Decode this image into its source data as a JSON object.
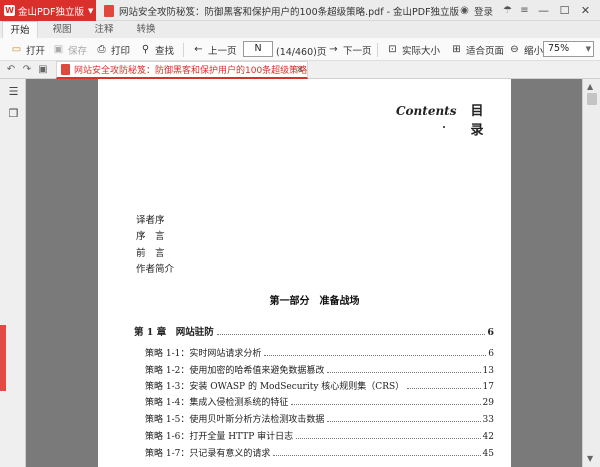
{
  "app": {
    "name": "金山PDF独立版",
    "window_title": "网站安全攻防秘笈：防御黑客和保护用户的100条超级策略.pdf - 金山PDF独立版",
    "login": "登录"
  },
  "menu_tabs": [
    "开始",
    "视图",
    "注释",
    "转换"
  ],
  "toolbar": {
    "open": "打开",
    "save": "保存",
    "print": "打印",
    "find": "查找",
    "prev_page": "上一页",
    "page_input": "N",
    "page_count": "(14/460)页",
    "next_page": "下一页",
    "actual_size": "实际大小",
    "fit_page": "适合页面",
    "zoom_out": "缩小",
    "zoom_value": "75%"
  },
  "document_tab": {
    "title": "网站安全攻防秘笈：防御黑客和保护用户的100条超级策略.pdf"
  },
  "page": {
    "contents_en": "Contents",
    "contents_zh": "目 录",
    "front_matter": [
      "译者序",
      "序　言",
      "前　言",
      "作者简介"
    ],
    "part_title": "第一部分　准备战场",
    "chapter": {
      "title": "第 1 章　网站驻防",
      "page": "6"
    },
    "entries": [
      {
        "title": "策略 1-1：实时网站请求分析",
        "page": "6"
      },
      {
        "title": "策略 1-2：使用加密的哈希值来避免数据篡改",
        "page": "13"
      },
      {
        "title": "策略 1-3：安装 OWASP 的 ModSecurity 核心规则集（CRS）",
        "page": "17"
      },
      {
        "title": "策略 1-4：集成入侵检测系统的特征",
        "page": "29"
      },
      {
        "title": "策略 1-5：使用贝叶斯分析方法检测攻击数据",
        "page": "33"
      },
      {
        "title": "策略 1-6：打开全量 HTTP 审计日志",
        "page": "42"
      },
      {
        "title": "策略 1-7：只记录有意义的请求",
        "page": "45"
      }
    ]
  },
  "colors": {
    "accent": "#d9302c",
    "page_bg": "#ffffff",
    "viewer_bg": "#7a7a7a"
  }
}
